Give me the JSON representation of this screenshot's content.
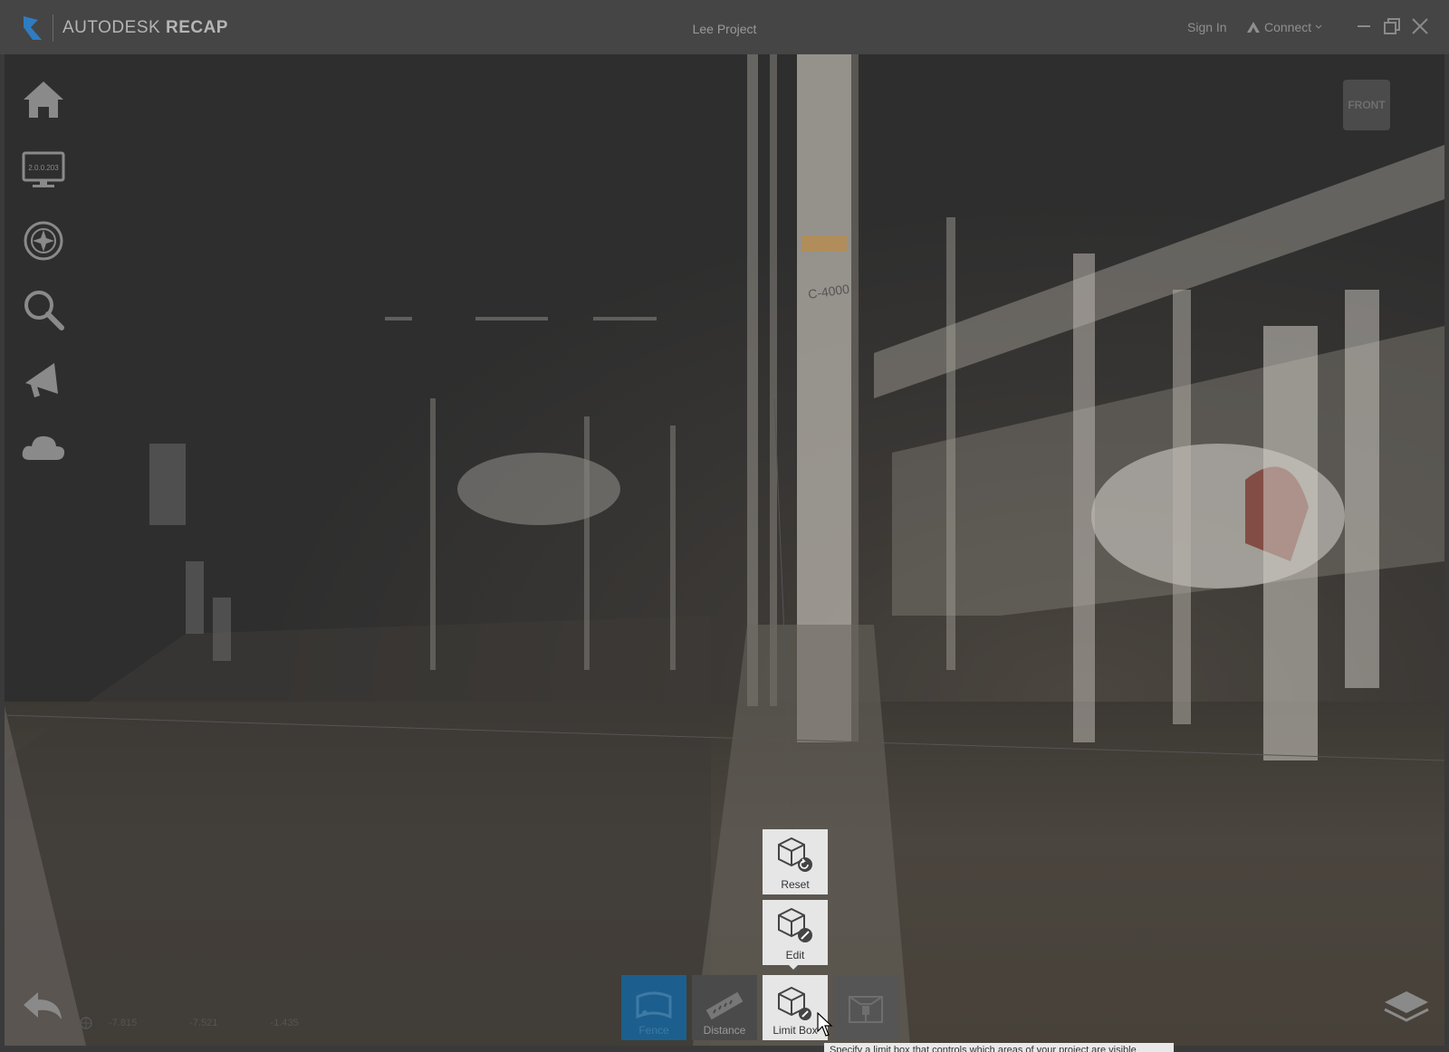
{
  "app": {
    "brand_plain": "AUTODESK",
    "brand_bold": "RECAP",
    "project_title": "Lee Project",
    "sign_in": "Sign In",
    "connect": "Connect"
  },
  "sidebar": {
    "items": [
      {
        "name": "home-icon"
      },
      {
        "name": "monitor-icon",
        "label": "2.0.0.203"
      },
      {
        "name": "navigation-wheel-icon"
      },
      {
        "name": "search-icon"
      },
      {
        "name": "megaphone-icon"
      },
      {
        "name": "cloud-icon"
      }
    ]
  },
  "viewcube": {
    "label": "FRONT"
  },
  "limit_box_menu": {
    "reset": "Reset",
    "edit": "Edit"
  },
  "toolbar": {
    "fence": "Fence",
    "distance": "Distance",
    "limit_box": "Limit Box"
  },
  "tooltip": {
    "text": "Specify a limit box that controls which areas of your project are visible"
  },
  "coordinates": {
    "x": "-7.815",
    "y": "-7.521",
    "z": "-1.435"
  },
  "colors": {
    "accent": "#1c5f8e",
    "titlebar": "#454545",
    "logo": "#2f7cc2"
  }
}
